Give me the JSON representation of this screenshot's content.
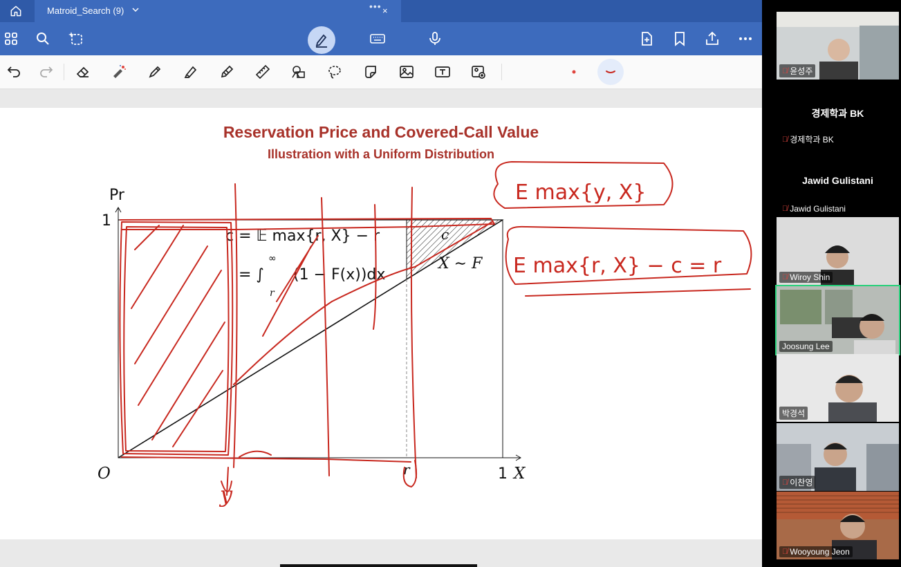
{
  "tab": {
    "title": "Matroid_Search (9)",
    "dots": "•••",
    "close": "×"
  },
  "slide": {
    "title": "Reservation Price and Covered-Call Value",
    "subtitle": "Illustration with a Uniform Distribution",
    "y_axis": "Pr",
    "y_one": "1",
    "origin": "O",
    "x_one": "1",
    "x_axis": "X",
    "eq1": "c = 𝔼 max{r, X} − r",
    "eq2_prefix": "= ∫",
    "eq2_upper": "∞",
    "eq2_lower": "r",
    "eq2_body": "(1 − F(x))dx",
    "c_label": "c",
    "dist_label": "X ∼ F",
    "r_tick": "r"
  },
  "handwriting": {
    "note1": "E max{y, X}",
    "note2": "E max{r, X} − c = r",
    "y_mark": "y"
  },
  "colors": {
    "brand": "#3d6bbd",
    "ink": "#c8281f",
    "title": "#a8322a",
    "active_speaker": "#27d07a"
  },
  "participants": [
    {
      "name": "윤성주",
      "muted": true,
      "video": true
    },
    {
      "name": "경제학과 BK",
      "muted": true,
      "video": false
    },
    {
      "name": "Jawid Gulistani",
      "muted": true,
      "video": false
    },
    {
      "name": "Wiroy Shin",
      "muted": true,
      "video": true
    },
    {
      "name": "Joosung Lee",
      "muted": false,
      "video": true
    },
    {
      "name": "박경석",
      "muted": false,
      "video": true
    },
    {
      "name": "이찬영",
      "muted": true,
      "video": true
    },
    {
      "name": "Wooyoung Jeon",
      "muted": true,
      "video": true
    }
  ]
}
